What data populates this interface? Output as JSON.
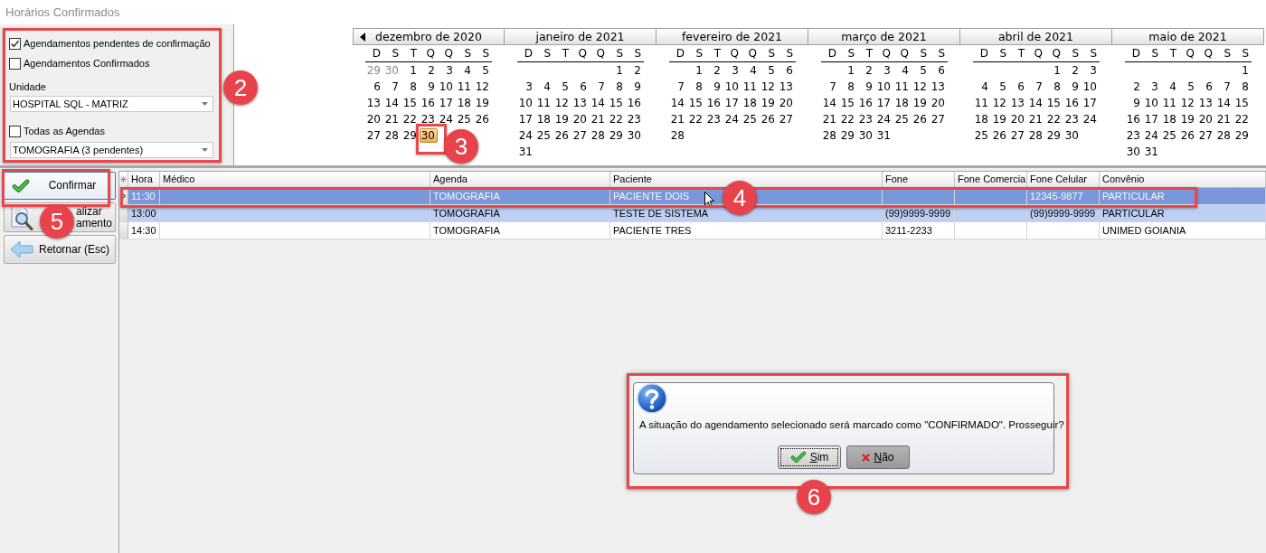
{
  "window": {
    "title": "Horários Confirmados"
  },
  "filters": {
    "pending": {
      "label": "Agendamentos pendentes de confirmação",
      "checked": true
    },
    "confirmed": {
      "label": "Agendamentos Confirmados",
      "checked": false
    },
    "unit": {
      "label": "Unidade",
      "value": "HOSPITAL SQL - MATRIZ"
    },
    "all_agendas": {
      "label": "Todas as Agendas",
      "checked": false
    },
    "agenda": {
      "value": "TOMOGRAFIA (3 pendentes)"
    }
  },
  "calendar": {
    "months": [
      {
        "title": "dezembro de 2020",
        "prev_button": true,
        "weekdays": [
          "D",
          "S",
          "T",
          "Q",
          "Q",
          "S",
          "S"
        ],
        "weeks": [
          {
            "kind": "regular",
            "days": [
              {
                "day": "29",
                "kind": "adjacent",
                "selected": false
              },
              {
                "day": "30",
                "kind": "adjacent",
                "selected": false
              },
              {
                "day": "1",
                "kind": "current",
                "selected": false
              },
              {
                "day": "2",
                "kind": "current",
                "selected": false
              },
              {
                "day": "3",
                "kind": "current",
                "selected": false
              },
              {
                "day": "4",
                "kind": "current",
                "selected": false
              },
              {
                "day": "5",
                "kind": "current",
                "selected": false
              }
            ]
          },
          {
            "kind": "regular",
            "days": [
              {
                "day": "6",
                "kind": "current",
                "selected": false
              },
              {
                "day": "7",
                "kind": "current",
                "selected": false
              },
              {
                "day": "8",
                "kind": "current",
                "selected": false
              },
              {
                "day": "9",
                "kind": "current",
                "selected": false
              },
              {
                "day": "10",
                "kind": "current",
                "selected": false
              },
              {
                "day": "11",
                "kind": "current",
                "selected": false
              },
              {
                "day": "12",
                "kind": "current",
                "selected": false
              }
            ]
          },
          {
            "kind": "regular",
            "days": [
              {
                "day": "13",
                "kind": "current",
                "selected": false
              },
              {
                "day": "14",
                "kind": "current",
                "selected": false
              },
              {
                "day": "15",
                "kind": "current",
                "selected": false
              },
              {
                "day": "16",
                "kind": "current",
                "selected": false
              },
              {
                "day": "17",
                "kind": "current",
                "selected": false
              },
              {
                "day": "18",
                "kind": "current",
                "selected": false
              },
              {
                "day": "19",
                "kind": "current",
                "selected": false
              }
            ]
          },
          {
            "kind": "regular",
            "days": [
              {
                "day": "20",
                "kind": "current",
                "selected": false
              },
              {
                "day": "21",
                "kind": "current",
                "selected": false
              },
              {
                "day": "22",
                "kind": "current",
                "selected": false
              },
              {
                "day": "23",
                "kind": "current",
                "selected": false
              },
              {
                "day": "24",
                "kind": "current",
                "selected": false
              },
              {
                "day": "25",
                "kind": "current",
                "selected": false
              },
              {
                "day": "26",
                "kind": "current",
                "selected": false
              }
            ]
          },
          {
            "kind": "regular",
            "days": [
              {
                "day": "27",
                "kind": "current",
                "selected": false
              },
              {
                "day": "28",
                "kind": "current",
                "selected": false
              },
              {
                "day": "29",
                "kind": "current",
                "selected": false
              },
              {
                "day": "30",
                "kind": "current",
                "selected": true
              }
            ]
          }
        ]
      },
      {
        "title": "janeiro de 2021",
        "prev_button": false,
        "weekdays": [
          "D",
          "S",
          "T",
          "Q",
          "Q",
          "S",
          "S"
        ],
        "weeks": [
          {
            "kind": "leading",
            "days": [
              {
                "day": "1",
                "kind": "current",
                "selected": false
              },
              {
                "day": "2",
                "kind": "current",
                "selected": false
              }
            ]
          },
          {
            "kind": "regular",
            "days": [
              {
                "day": "3",
                "kind": "current",
                "selected": false
              },
              {
                "day": "4",
                "kind": "current",
                "selected": false
              },
              {
                "day": "5",
                "kind": "current",
                "selected": false
              },
              {
                "day": "6",
                "kind": "current",
                "selected": false
              },
              {
                "day": "7",
                "kind": "current",
                "selected": false
              },
              {
                "day": "8",
                "kind": "current",
                "selected": false
              },
              {
                "day": "9",
                "kind": "current",
                "selected": false
              }
            ]
          },
          {
            "kind": "regular",
            "days": [
              {
                "day": "10",
                "kind": "current",
                "selected": false
              },
              {
                "day": "11",
                "kind": "current",
                "selected": false
              },
              {
                "day": "12",
                "kind": "current",
                "selected": false
              },
              {
                "day": "13",
                "kind": "current",
                "selected": false
              },
              {
                "day": "14",
                "kind": "current",
                "selected": false
              },
              {
                "day": "15",
                "kind": "current",
                "selected": false
              },
              {
                "day": "16",
                "kind": "current",
                "selected": false
              }
            ]
          },
          {
            "kind": "regular",
            "days": [
              {
                "day": "17",
                "kind": "current",
                "selected": false
              },
              {
                "day": "18",
                "kind": "current",
                "selected": false
              },
              {
                "day": "19",
                "kind": "current",
                "selected": false
              },
              {
                "day": "20",
                "kind": "current",
                "selected": false
              },
              {
                "day": "21",
                "kind": "current",
                "selected": false
              },
              {
                "day": "22",
                "kind": "current",
                "selected": false
              },
              {
                "day": "23",
                "kind": "current",
                "selected": false
              }
            ]
          },
          {
            "kind": "regular",
            "days": [
              {
                "day": "24",
                "kind": "current",
                "selected": false
              },
              {
                "day": "25",
                "kind": "current",
                "selected": false
              },
              {
                "day": "26",
                "kind": "current",
                "selected": false
              },
              {
                "day": "27",
                "kind": "current",
                "selected": false
              },
              {
                "day": "28",
                "kind": "current",
                "selected": false
              },
              {
                "day": "29",
                "kind": "current",
                "selected": false
              },
              {
                "day": "30",
                "kind": "current",
                "selected": false
              }
            ]
          },
          {
            "kind": "regular",
            "days": [
              {
                "day": "31",
                "kind": "current",
                "selected": false
              }
            ]
          }
        ]
      },
      {
        "title": "fevereiro de 2021",
        "prev_button": false,
        "weekdays": [
          "D",
          "S",
          "T",
          "Q",
          "Q",
          "S",
          "S"
        ],
        "weeks": [
          {
            "kind": "leading",
            "days": [
              {
                "day": "1",
                "kind": "current",
                "selected": false
              },
              {
                "day": "2",
                "kind": "current",
                "selected": false
              },
              {
                "day": "3",
                "kind": "current",
                "selected": false
              },
              {
                "day": "4",
                "kind": "current",
                "selected": false
              },
              {
                "day": "5",
                "kind": "current",
                "selected": false
              },
              {
                "day": "6",
                "kind": "current",
                "selected": false
              }
            ]
          },
          {
            "kind": "regular",
            "days": [
              {
                "day": "7",
                "kind": "current",
                "selected": false
              },
              {
                "day": "8",
                "kind": "current",
                "selected": false
              },
              {
                "day": "9",
                "kind": "current",
                "selected": false
              },
              {
                "day": "10",
                "kind": "current",
                "selected": false
              },
              {
                "day": "11",
                "kind": "current",
                "selected": false
              },
              {
                "day": "12",
                "kind": "current",
                "selected": false
              },
              {
                "day": "13",
                "kind": "current",
                "selected": false
              }
            ]
          },
          {
            "kind": "regular",
            "days": [
              {
                "day": "14",
                "kind": "current",
                "selected": false
              },
              {
                "day": "15",
                "kind": "current",
                "selected": false
              },
              {
                "day": "16",
                "kind": "current",
                "selected": false
              },
              {
                "day": "17",
                "kind": "current",
                "selected": false
              },
              {
                "day": "18",
                "kind": "current",
                "selected": false
              },
              {
                "day": "19",
                "kind": "current",
                "selected": false
              },
              {
                "day": "20",
                "kind": "current",
                "selected": false
              }
            ]
          },
          {
            "kind": "regular",
            "days": [
              {
                "day": "21",
                "kind": "current",
                "selected": false
              },
              {
                "day": "22",
                "kind": "current",
                "selected": false
              },
              {
                "day": "23",
                "kind": "current",
                "selected": false
              },
              {
                "day": "24",
                "kind": "current",
                "selected": false
              },
              {
                "day": "25",
                "kind": "current",
                "selected": false
              },
              {
                "day": "26",
                "kind": "current",
                "selected": false
              },
              {
                "day": "27",
                "kind": "current",
                "selected": false
              }
            ]
          },
          {
            "kind": "regular",
            "days": [
              {
                "day": "28",
                "kind": "current",
                "selected": false
              }
            ]
          }
        ]
      },
      {
        "title": "março de 2021",
        "prev_button": false,
        "weekdays": [
          "D",
          "S",
          "T",
          "Q",
          "Q",
          "S",
          "S"
        ],
        "weeks": [
          {
            "kind": "leading",
            "days": [
              {
                "day": "1",
                "kind": "current",
                "selected": false
              },
              {
                "day": "2",
                "kind": "current",
                "selected": false
              },
              {
                "day": "3",
                "kind": "current",
                "selected": false
              },
              {
                "day": "4",
                "kind": "current",
                "selected": false
              },
              {
                "day": "5",
                "kind": "current",
                "selected": false
              },
              {
                "day": "6",
                "kind": "current",
                "selected": false
              }
            ]
          },
          {
            "kind": "regular",
            "days": [
              {
                "day": "7",
                "kind": "current",
                "selected": false
              },
              {
                "day": "8",
                "kind": "current",
                "selected": false
              },
              {
                "day": "9",
                "kind": "current",
                "selected": false
              },
              {
                "day": "10",
                "kind": "current",
                "selected": false
              },
              {
                "day": "11",
                "kind": "current",
                "selected": false
              },
              {
                "day": "12",
                "kind": "current",
                "selected": false
              },
              {
                "day": "13",
                "kind": "current",
                "selected": false
              }
            ]
          },
          {
            "kind": "regular",
            "days": [
              {
                "day": "14",
                "kind": "current",
                "selected": false
              },
              {
                "day": "15",
                "kind": "current",
                "selected": false
              },
              {
                "day": "16",
                "kind": "current",
                "selected": false
              },
              {
                "day": "17",
                "kind": "current",
                "selected": false
              },
              {
                "day": "18",
                "kind": "current",
                "selected": false
              },
              {
                "day": "19",
                "kind": "current",
                "selected": false
              },
              {
                "day": "20",
                "kind": "current",
                "selected": false
              }
            ]
          },
          {
            "kind": "regular",
            "days": [
              {
                "day": "21",
                "kind": "current",
                "selected": false
              },
              {
                "day": "22",
                "kind": "current",
                "selected": false
              },
              {
                "day": "23",
                "kind": "current",
                "selected": false
              },
              {
                "day": "24",
                "kind": "current",
                "selected": false
              },
              {
                "day": "25",
                "kind": "current",
                "selected": false
              },
              {
                "day": "26",
                "kind": "current",
                "selected": false
              },
              {
                "day": "27",
                "kind": "current",
                "selected": false
              }
            ]
          },
          {
            "kind": "regular",
            "days": [
              {
                "day": "28",
                "kind": "current",
                "selected": false
              },
              {
                "day": "29",
                "kind": "current",
                "selected": false
              },
              {
                "day": "30",
                "kind": "current",
                "selected": false
              },
              {
                "day": "31",
                "kind": "current",
                "selected": false
              }
            ]
          }
        ]
      },
      {
        "title": "abril de 2021",
        "prev_button": false,
        "weekdays": [
          "D",
          "S",
          "T",
          "Q",
          "Q",
          "S",
          "S"
        ],
        "weeks": [
          {
            "kind": "leading",
            "days": [
              {
                "day": "1",
                "kind": "current",
                "selected": false
              },
              {
                "day": "2",
                "kind": "current",
                "selected": false
              },
              {
                "day": "3",
                "kind": "current",
                "selected": false
              }
            ]
          },
          {
            "kind": "regular",
            "days": [
              {
                "day": "4",
                "kind": "current",
                "selected": false
              },
              {
                "day": "5",
                "kind": "current",
                "selected": false
              },
              {
                "day": "6",
                "kind": "current",
                "selected": false
              },
              {
                "day": "7",
                "kind": "current",
                "selected": false
              },
              {
                "day": "8",
                "kind": "current",
                "selected": false
              },
              {
                "day": "9",
                "kind": "current",
                "selected": false
              },
              {
                "day": "10",
                "kind": "current",
                "selected": false
              }
            ]
          },
          {
            "kind": "regular",
            "days": [
              {
                "day": "11",
                "kind": "current",
                "selected": false
              },
              {
                "day": "12",
                "kind": "current",
                "selected": false
              },
              {
                "day": "13",
                "kind": "current",
                "selected": false
              },
              {
                "day": "14",
                "kind": "current",
                "selected": false
              },
              {
                "day": "15",
                "kind": "current",
                "selected": false
              },
              {
                "day": "16",
                "kind": "current",
                "selected": false
              },
              {
                "day": "17",
                "kind": "current",
                "selected": false
              }
            ]
          },
          {
            "kind": "regular",
            "days": [
              {
                "day": "18",
                "kind": "current",
                "selected": false
              },
              {
                "day": "19",
                "kind": "current",
                "selected": false
              },
              {
                "day": "20",
                "kind": "current",
                "selected": false
              },
              {
                "day": "21",
                "kind": "current",
                "selected": false
              },
              {
                "day": "22",
                "kind": "current",
                "selected": false
              },
              {
                "day": "23",
                "kind": "current",
                "selected": false
              },
              {
                "day": "24",
                "kind": "current",
                "selected": false
              }
            ]
          },
          {
            "kind": "regular",
            "days": [
              {
                "day": "25",
                "kind": "current",
                "selected": false
              },
              {
                "day": "26",
                "kind": "current",
                "selected": false
              },
              {
                "day": "27",
                "kind": "current",
                "selected": false
              },
              {
                "day": "28",
                "kind": "current",
                "selected": false
              },
              {
                "day": "29",
                "kind": "current",
                "selected": false
              },
              {
                "day": "30",
                "kind": "current",
                "selected": false
              }
            ]
          }
        ]
      },
      {
        "title": "maio de 2021",
        "prev_button": false,
        "weekdays": [
          "D",
          "S",
          "T",
          "Q",
          "Q",
          "S",
          "S"
        ],
        "weeks": [
          {
            "kind": "leading",
            "days": [
              {
                "day": "1",
                "kind": "current",
                "selected": false
              }
            ]
          },
          {
            "kind": "regular",
            "days": [
              {
                "day": "2",
                "kind": "current",
                "selected": false
              },
              {
                "day": "3",
                "kind": "current",
                "selected": false
              },
              {
                "day": "4",
                "kind": "current",
                "selected": false
              },
              {
                "day": "5",
                "kind": "current",
                "selected": false
              },
              {
                "day": "6",
                "kind": "current",
                "selected": false
              },
              {
                "day": "7",
                "kind": "current",
                "selected": false
              },
              {
                "day": "8",
                "kind": "current",
                "selected": false
              }
            ]
          },
          {
            "kind": "regular",
            "days": [
              {
                "day": "9",
                "kind": "current",
                "selected": false
              },
              {
                "day": "10",
                "kind": "current",
                "selected": false
              },
              {
                "day": "11",
                "kind": "current",
                "selected": false
              },
              {
                "day": "12",
                "kind": "current",
                "selected": false
              },
              {
                "day": "13",
                "kind": "current",
                "selected": false
              },
              {
                "day": "14",
                "kind": "current",
                "selected": false
              },
              {
                "day": "15",
                "kind": "current",
                "selected": false
              }
            ]
          },
          {
            "kind": "regular",
            "days": [
              {
                "day": "16",
                "kind": "current",
                "selected": false
              },
              {
                "day": "17",
                "kind": "current",
                "selected": false
              },
              {
                "day": "18",
                "kind": "current",
                "selected": false
              },
              {
                "day": "19",
                "kind": "current",
                "selected": false
              },
              {
                "day": "20",
                "kind": "current",
                "selected": false
              },
              {
                "day": "21",
                "kind": "current",
                "selected": false
              },
              {
                "day": "22",
                "kind": "current",
                "selected": false
              }
            ]
          },
          {
            "kind": "regular",
            "days": [
              {
                "day": "23",
                "kind": "current",
                "selected": false
              },
              {
                "day": "24",
                "kind": "current",
                "selected": false
              },
              {
                "day": "25",
                "kind": "current",
                "selected": false
              },
              {
                "day": "26",
                "kind": "current",
                "selected": false
              },
              {
                "day": "27",
                "kind": "current",
                "selected": false
              },
              {
                "day": "28",
                "kind": "current",
                "selected": false
              },
              {
                "day": "29",
                "kind": "current",
                "selected": false
              }
            ]
          },
          {
            "kind": "regular",
            "days": [
              {
                "day": "30",
                "kind": "current",
                "selected": false
              },
              {
                "day": "31",
                "kind": "current",
                "selected": false
              }
            ]
          }
        ]
      }
    ]
  },
  "actions": [
    {
      "kind": "confirm",
      "label_lines": [
        "Confirmar"
      ],
      "focused": true
    },
    {
      "kind": "view",
      "label_lines": [
        "alizar",
        "amento"
      ],
      "focused": false
    },
    {
      "kind": "back",
      "label_lines": [
        "Retornar (Esc)"
      ],
      "focused": false
    }
  ],
  "grid": {
    "columns": [
      "Hora",
      "Médico",
      "Agenda",
      "Paciente",
      "Fone",
      "Fone Comercia",
      "Fone Celular",
      "Convênio"
    ],
    "rows": [
      {
        "selected": true,
        "highlighted": false,
        "hora": "11:30",
        "agenda": "TOMOGRAFIA",
        "paciente": "PACIENTE DOIS",
        "fone_celular": "12345-9877",
        "convenio": "PARTICULAR"
      },
      {
        "selected": false,
        "highlighted": true,
        "hora": "13:00",
        "agenda": "TOMOGRAFIA",
        "paciente": "TESTE DE SISTEMA",
        "fone": "(99)9999-9999",
        "fone_celular": "(99)9999-9999",
        "convenio": "PARTICULAR"
      },
      {
        "selected": false,
        "highlighted": false,
        "hora": "14:30",
        "agenda": "TOMOGRAFIA",
        "paciente": "PACIENTE TRES",
        "fone": "3211-2233",
        "convenio": "UNIMED GOIANIA"
      }
    ]
  },
  "dialog": {
    "message": "A situação do agendamento selecionado será marcado como \"CONFIRMADO\". Prosseguir?",
    "buttons": [
      {
        "kind": "yes",
        "label": "Sim",
        "focused": true,
        "hovered": false,
        "underline_first": true
      },
      {
        "kind": "no",
        "label": "Não",
        "focused": false,
        "hovered": true,
        "underline_first": true
      }
    ]
  },
  "callouts": [
    {
      "label": "2",
      "framed": true
    },
    {
      "label": "3",
      "framed": true
    },
    {
      "label": "4",
      "framed": true
    },
    {
      "label": "5",
      "framed": true
    },
    {
      "label": "6",
      "framed": true
    }
  ]
}
